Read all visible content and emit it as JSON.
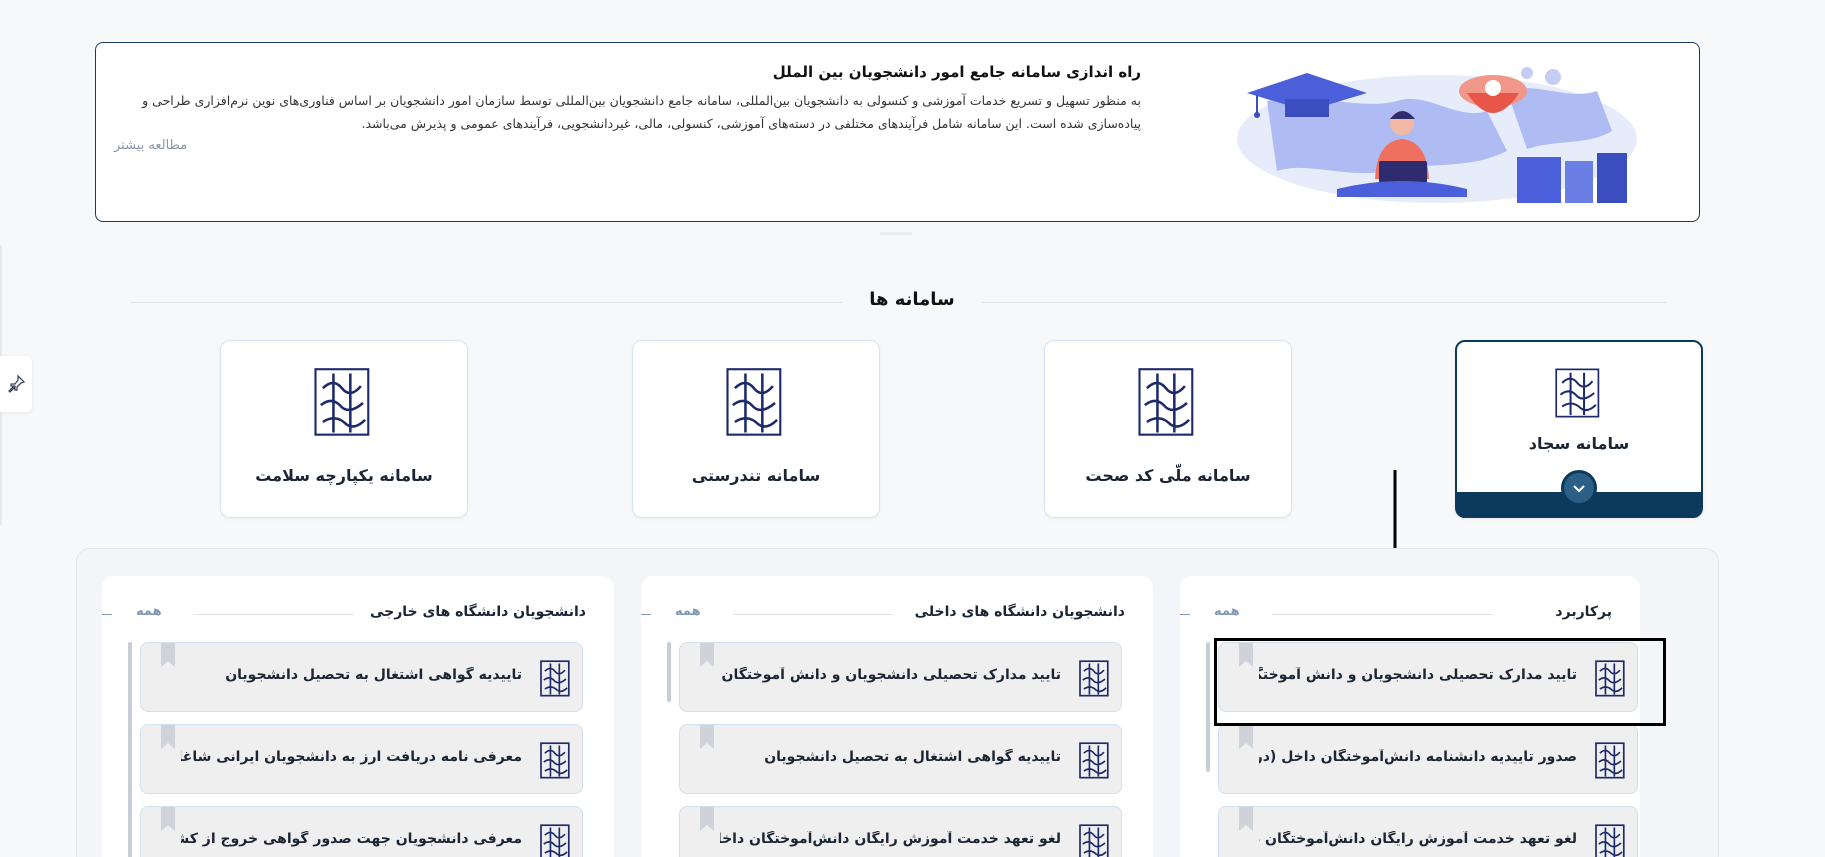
{
  "banner": {
    "title": "راه اندازی سامانه جامع امور دانشجویان بین الملل",
    "body_line1": "به منظور تسهیل و تسریع خدمات آموزشی و کنسولی به دانشجویان بین‌المللی، سامانه جامع دانشجویان بین‌المللی توسط سازمان امور دانشجویان بر اساس فناوری‌های نوین نرم‌افزاری طراحی و",
    "body_line2": "پیاده‌سازی شده است. این سامانه شامل فرآیندهای مختلفی در دسته‌های آموزشی، کنسولی، مالی، غیردانشجویی، فرآیندهای عمومی و پذیرش می‌باشد.",
    "read_more": "مطالعه بیشتر"
  },
  "systems": {
    "title": "سامانه ها",
    "cards": [
      {
        "label": "سامانه سجاد"
      },
      {
        "label": "سامانه ملّی کد صحت"
      },
      {
        "label": "سامانه تندرستی"
      },
      {
        "label": "سامانه یکپارچه سلامت"
      }
    ]
  },
  "columns": [
    {
      "title": "پرکاربرد",
      "all": "همه",
      "items": [
        "تایید مدارک تحصیلی دانشجویان و دانش آموختگان ج",
        "صدور تاییدیه دانشنامه دانش‌آموختگان داخل (دریافت",
        "لغو تعهد خدمت آموزش رایگان دانش‌آموختگان داخل"
      ]
    },
    {
      "title": "دانشجویان دانشگاه های داخلی",
      "all": "همه",
      "items": [
        "تایید مدارک تحصیلی دانشجویان و دانش آموختگان ج",
        "تاییدیه گواهی اشتغال به تحصیل دانشجویان",
        "لغو تعهد خدمت آموزش رایگان دانش‌آموختگان داخل"
      ]
    },
    {
      "title": "دانشجویان دانشگاه های خارجی",
      "all": "همه",
      "items": [
        "تاییدیه گواهی اشتغال به تحصیل دانشجویان",
        "معرفی نامه دریافت ارز به دانشجویان ایرانی شاغل به تح",
        "معرفی دانشجویان جهت صدور گواهی خروج از کشور ب"
      ]
    }
  ],
  "colors": {
    "accent": "#0b3a5c",
    "link": "#7f97b5",
    "border": "#cfe0f2"
  }
}
